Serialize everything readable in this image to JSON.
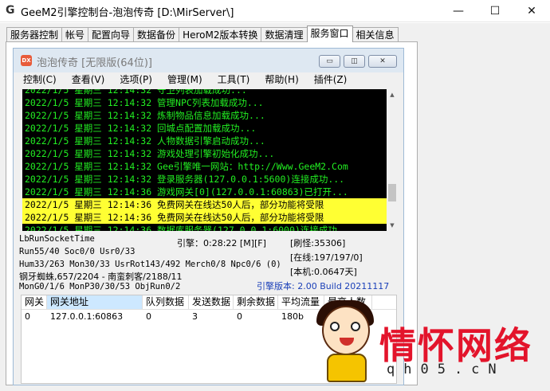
{
  "window": {
    "title": "GeeM2引擎控制台-泡泡传奇 [D:\\MirServer\\]",
    "icon_letter": "G",
    "min_glyph": "—",
    "max_glyph": "☐",
    "close_glyph": "✕"
  },
  "tabs": [
    {
      "label": "服务器控制"
    },
    {
      "label": "帐号"
    },
    {
      "label": "配置向导"
    },
    {
      "label": "数据备份"
    },
    {
      "label": "HeroM2版本转换"
    },
    {
      "label": "数据清理"
    },
    {
      "label": "服务窗口",
      "active": true
    },
    {
      "label": "相关信息"
    }
  ],
  "inner": {
    "title": "泡泡传奇 [无限版(64位)]",
    "icon_text": "DX",
    "min_glyph": "▭",
    "max_glyph": "◫",
    "close_glyph": "✕"
  },
  "menu": [
    "控制(C)",
    "查看(V)",
    "选项(P)",
    "管理(M)",
    "工具(T)",
    "帮助(H)",
    "插件(Z)"
  ],
  "log": [
    {
      "text": "2022/1/5 星期三 12:14:32 守卫列表加载成功...",
      "warn": false
    },
    {
      "text": "2022/1/5 星期三 12:14:32 管理NPC列表加载成功...",
      "warn": false
    },
    {
      "text": "2022/1/5 星期三 12:14:32 炼制物品信息加载成功...",
      "warn": false
    },
    {
      "text": "2022/1/5 星期三 12:14:32 回城点配置加载成功...",
      "warn": false
    },
    {
      "text": "2022/1/5 星期三 12:14:32 人物数据引擎启动成功...",
      "warn": false
    },
    {
      "text": "2022/1/5 星期三 12:14:32 游戏处理引擎初始化成功...",
      "warn": false
    },
    {
      "text": "2022/1/5 星期三 12:14:32 Gee引擎唯一网站：http://Www.GeeM2.Com",
      "warn": false
    },
    {
      "text": "2022/1/5 星期三 12:14:32 登录服务器(127.0.0.1:5600)连接成功...",
      "warn": false
    },
    {
      "text": "2022/1/5 星期三 12:14:36 游戏网关[0](127.0.0.1:60863)已打开...",
      "warn": false
    },
    {
      "text": "2022/1/5 星期三 12:14:36 免费网关在线达50人后，部分功能将受限",
      "warn": true
    },
    {
      "text": "2022/1/5 星期三 12:14:36 免费网关在线达50人后，部分功能将受限",
      "warn": true
    },
    {
      "text": "2022/1/5 星期三 12:14:36 数据库服务器(127.0.0.1:6000)连接成功",
      "warn": false
    }
  ],
  "scroll": {
    "up": "▲",
    "down": "▼"
  },
  "status": {
    "run_socket": "LbRunSocketTime",
    "engine_time": "引擎：0:28:22 [M][F]",
    "refresh": "[刷怪:35306]",
    "run_line": "Run55/40 Soc0/0 Usr0/33",
    "online": "[在线:197/197/0]",
    "hum_line": "Hum33/263 Mon30/33 UsrRot143/492 Merch0/8 Npc0/6 (0)",
    "local": "[本机:0.0647天]",
    "map_line": "钢牙蜘蛛,657/2204 - 南蛮刺客/2188/11",
    "mon_line": "MonG0/1/6 MonP30/30/53 ObjRun0/2",
    "version": "引擎版本: 2.00 Build 20211117"
  },
  "gate_table": {
    "headers": [
      "网关",
      "网关地址",
      "队列数据",
      "发送数据",
      "剩余数据",
      "平均流量",
      "最高人数"
    ],
    "rows": [
      [
        "0",
        "127.0.0.1:60863",
        "0",
        "3",
        "0",
        "180b",
        ""
      ]
    ]
  },
  "watermark": {
    "text": "情怀网络",
    "sub": "qh05.cN"
  }
}
